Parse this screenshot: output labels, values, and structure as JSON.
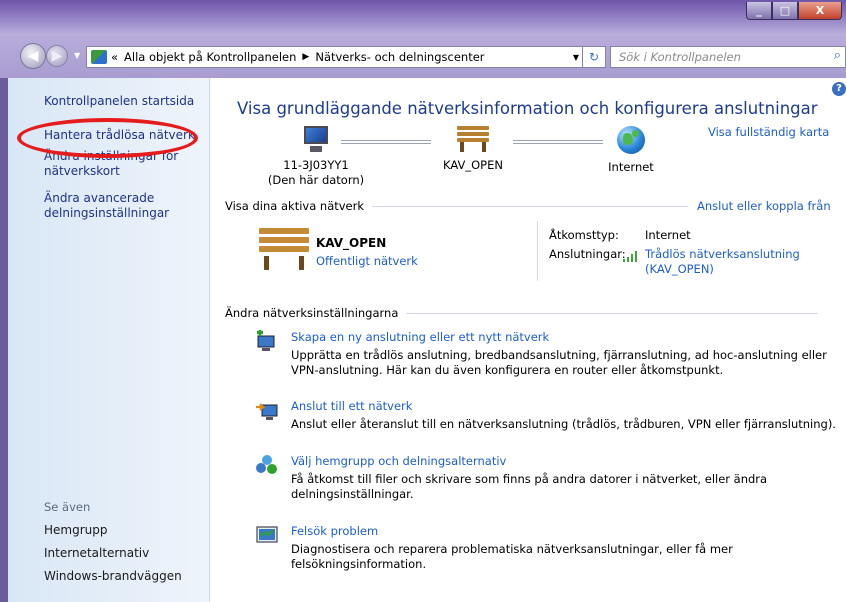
{
  "window": {
    "controls": {
      "minimize": "_",
      "maximize": "□",
      "close": "X"
    }
  },
  "address_bar": {
    "path": [
      "«",
      "Alla objekt på Kontrollpanelen",
      "Nätverks- och delningscenter"
    ],
    "search_placeholder": "Sök i Kontrollpanelen"
  },
  "sidebar": {
    "links": [
      "Kontrollpanelen startsida",
      "Hantera trådlösa nätverk",
      "Ändra inställningar för nätverkskort",
      "Ändra avancerade delningsinställningar"
    ],
    "see_also_label": "Se även",
    "see_also": [
      "Hemgrupp",
      "Internetalternativ",
      "Windows-brandväggen"
    ]
  },
  "main": {
    "title": "Visa grundläggande nätverksinformation och konfigurera anslutningar",
    "full_map_link": "Visa fullständig karta",
    "map": {
      "computer_name": "11-3J03YY1",
      "computer_sub": "(Den här datorn)",
      "network": "KAV_OPEN",
      "internet": "Internet"
    },
    "active_networks": {
      "header": "Visa dina aktiva nätverk",
      "connect_link": "Anslut eller koppla från",
      "network_name": "KAV_OPEN",
      "network_type": "Offentligt nätverk",
      "access_type_label": "Åtkomsttyp:",
      "access_type_value": "Internet",
      "connections_label": "Anslutningar:",
      "connection_value_line1": "Trådlös nätverksanslutning",
      "connection_value_line2": "(KAV_OPEN)"
    },
    "settings": {
      "header": "Ändra nätverksinställningarna",
      "tasks": [
        {
          "title": "Skapa en ny anslutning eller ett nytt nätverk",
          "desc": "Upprätta en trådlös anslutning, bredbandsanslutning, fjärranslutning, ad hoc-anslutning eller VPN-anslutning. Här kan du även konfigurera en router eller åtkomstpunkt."
        },
        {
          "title": "Anslut till ett nätverk",
          "desc": "Anslut eller återanslut till en nätverksanslutning (trådlös, trådburen, VPN eller fjärranslutning)."
        },
        {
          "title": "Välj hemgrupp och delningsalternativ",
          "desc": "Få åtkomst till filer och skrivare som finns på andra datorer i nätverket, eller ändra delningsinställningar."
        },
        {
          "title": "Felsök problem",
          "desc": "Diagnostisera och reparera problematiska nätverksanslutningar, eller få mer felsökningsinformation."
        }
      ]
    }
  },
  "colors": {
    "link": "#1f5ec5",
    "title": "#1e3c8c",
    "highlight_oval": "#e51c1c"
  }
}
